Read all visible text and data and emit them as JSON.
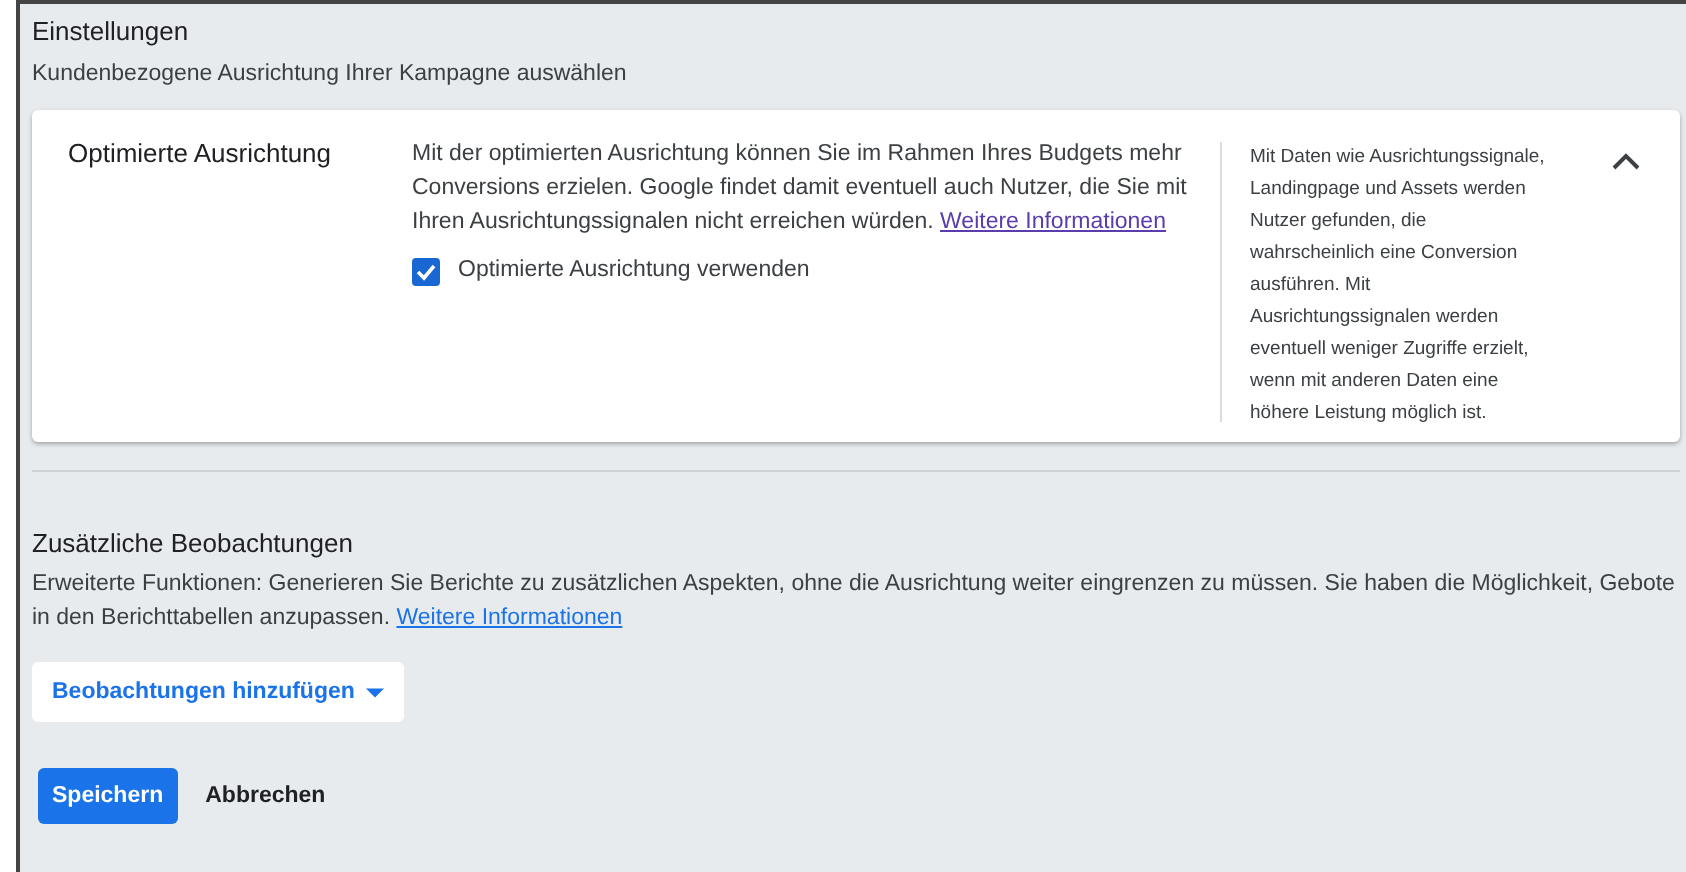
{
  "header": {
    "title": "Einstellungen",
    "subtitle": "Kundenbezogene Ausrichtung Ihrer Kampagne auswählen"
  },
  "card": {
    "title": "Optimierte Ausrichtung",
    "description": "Mit der optimierten Ausrichtung können Sie im Rahmen Ihres Budgets mehr Conversions erzielen. Google findet damit eventuell auch Nutzer, die Sie mit Ihren Ausrichtungssignalen nicht erreichen würden.",
    "link": "Weitere Informationen",
    "checkbox": {
      "label": "Optimierte Ausrichtung verwenden",
      "checked": true
    },
    "aside": "Mit Daten wie Ausrichtungssignale, Landingpage und Assets werden Nutzer gefunden, die wahrscheinlich eine Conversion ausführen. Mit Ausrichtungssignalen werden eventuell weniger Zugriffe erzielt, wenn mit anderen Daten eine höhere Leistung möglich ist.",
    "expanded": true
  },
  "observations": {
    "title": "Zusätzliche Beobachtungen",
    "description": "Erweiterte Funktionen: Generieren Sie Berichte zu zusätzlichen Aspekten, ohne die Ausrichtung weiter eingrenzen zu müssen. Sie haben die Möglichkeit, Gebote in den Berichttabellen anzupassen.",
    "link": "Weitere Informationen",
    "dropdown": "Beobachtungen hinzufügen"
  },
  "buttons": [
    "Speichern",
    "Abbrechen"
  ]
}
